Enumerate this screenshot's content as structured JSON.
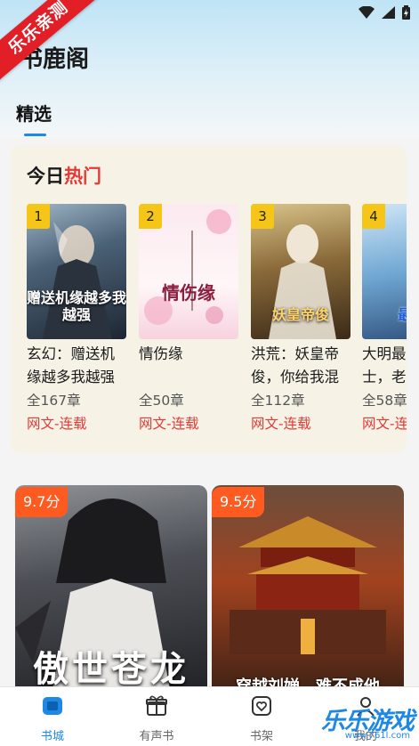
{
  "watermark_ribbon": "乐乐亲测",
  "app_title": "书鹿阁",
  "tabs": [
    {
      "label": "精选"
    }
  ],
  "hot": {
    "title_prefix": "今日",
    "title_highlight": "热门",
    "books": [
      {
        "rank": "1",
        "title": "玄幻：赠送机缘越多我越强",
        "chapters": "全167章",
        "tag": "网文-连载",
        "cover_text": "赠送机缘越多我越强"
      },
      {
        "rank": "2",
        "title": "情伤缘",
        "chapters": "全50章",
        "tag": "网文-连载",
        "cover_text": "情伤缘"
      },
      {
        "rank": "3",
        "title": "洪荒：妖皇帝俊，你给我混沌青莲?",
        "chapters": "全112章",
        "tag": "网文-连载",
        "cover_text": "妖皇帝俊"
      },
      {
        "rank": "4",
        "title": "大明最强道士，老朱：你给我复活阎王",
        "chapters": "全58章",
        "tag": "网文-连载",
        "cover_text": "最强"
      }
    ]
  },
  "featured": [
    {
      "score": "9.7分",
      "cover_text": "傲世苍龙"
    },
    {
      "score": "9.5分",
      "cover_text": "穿越刘婵，难不成他"
    }
  ],
  "nav": [
    {
      "label": "书城",
      "icon": "bookstore-icon",
      "active": true
    },
    {
      "label": "有声书",
      "icon": "gift-box-icon",
      "active": false
    },
    {
      "label": "书架",
      "icon": "bookshelf-heart-icon",
      "active": false
    },
    {
      "label": "我的",
      "icon": "user-icon",
      "active": false
    }
  ],
  "corner_watermark": {
    "text": "乐乐游戏",
    "url": "www.761l.com"
  },
  "colors": {
    "accent": "#1e88e5",
    "highlight": "#e53935",
    "rank_badge": "#f5c518",
    "score_badge": "#ff5a1f"
  }
}
